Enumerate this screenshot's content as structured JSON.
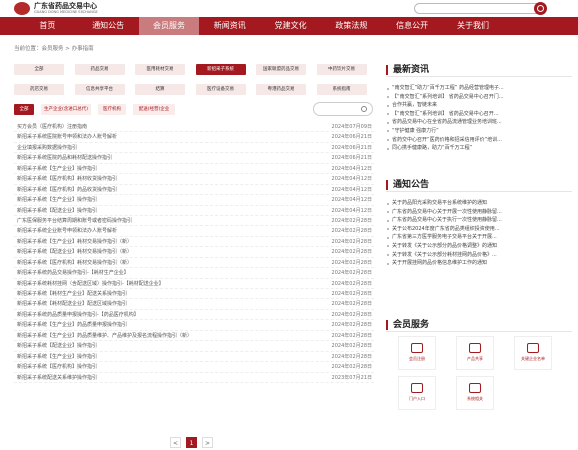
{
  "header": {
    "site_name": "广东省药品交易中心",
    "site_name_en": "GUANG DONG MEDICINE EXCHANGE"
  },
  "nav": {
    "items": [
      "首页",
      "通知公告",
      "会员服务",
      "新闻资讯",
      "党建文化",
      "政策法规",
      "信息公开",
      "关于我们"
    ],
    "active_index": 2
  },
  "breadcrumb": "当前位置：会员服务 > 办事指南",
  "category_tabs": [
    "全部",
    "药品交易",
    "医用耗材交易",
    "新招采子系统",
    "国家联盟药品交易",
    "中药饮片交易",
    "药店交易",
    "信息共享平台",
    "结算",
    "医疗设备交易",
    "粤港药品交易",
    "系统指南"
  ],
  "active_tab": "新招采子系统",
  "filters": [
    "全部",
    "生产企业(含进口总代)",
    "医疗机构",
    "配送(经营)企业"
  ],
  "active_filter": "全部",
  "list": [
    {
      "title": "买方会员（医疗机构）注册指南",
      "date": "2024年07月09日"
    },
    {
      "title": "新招采子系统医院账号申领和法办人账号解析",
      "date": "2024年06月21日"
    },
    {
      "title": "企业填报采购数据操作指引",
      "date": "2024年06月21日"
    },
    {
      "title": "新招采子系统医院药品和耗材配送操作指引",
      "date": "2024年06月21日"
    },
    {
      "title": "新招采子系统【生产企业】操作指引",
      "date": "2024年04月12日"
    },
    {
      "title": "新招采子系统【医疗机构】耗材收货操作指引",
      "date": "2024年04月12日"
    },
    {
      "title": "新招采子系统【医疗机构】药品收货操作指引",
      "date": "2024年04月12日"
    },
    {
      "title": "新招采子系统【生产企业】操作指引",
      "date": "2024年04月12日"
    },
    {
      "title": "新招采子系统【配送企业】操作指引",
      "date": "2024年04月12日"
    },
    {
      "title": "广东医保服务平台结算周期和账号或者密码操作指引",
      "date": "2024年02月28日"
    },
    {
      "title": "新招采子系统企业账号申领和法办人账号解析",
      "date": "2024年02月28日"
    },
    {
      "title": "新招采子系统【生产企业】耗材交易操作指引（新）",
      "date": "2024年02月28日"
    },
    {
      "title": "新招采子系统【配送企业】耗材交易操作指引（新）",
      "date": "2024年02月28日"
    },
    {
      "title": "新招采子系统【医疗机构】耗材交易操作指引（新）",
      "date": "2024年02月28日"
    },
    {
      "title": "新招采子系统药品交易操作指引-【耗材生产企业】",
      "date": "2024年02月28日"
    },
    {
      "title": "新招采子系统耗材挂网（含配送区域）操作指引-【耗材配送企业】",
      "date": "2024年02月28日"
    },
    {
      "title": "新招采子系统【耗材生产企业】配送关系操作指引",
      "date": "2024年02月28日"
    },
    {
      "title": "新招采子系统【耗材配送企业】配送区域操作指引",
      "date": "2024年02月28日"
    },
    {
      "title": "新招采子系统药品质量申报操作指引-【药品医疗机构】",
      "date": "2024年02月28日"
    },
    {
      "title": "新招采子系统【生产企业】药品质量申报操作指引",
      "date": "2024年02月28日"
    },
    {
      "title": "新招采子系统【生产企业】药品质量维护、产品维护及报名流程操作指引（新）",
      "date": "2024年02月28日"
    },
    {
      "title": "新招采子系统【配送企业】操作指引",
      "date": "2024年02月28日"
    },
    {
      "title": "新招采子系统【生产企业】操作指引",
      "date": "2024年02月28日"
    },
    {
      "title": "新招采子系统【医疗机构】操作指引",
      "date": "2024年02月28日"
    },
    {
      "title": "新招采子系统配送关系维护操作指引",
      "date": "2023年07月21日"
    }
  ],
  "pagination": {
    "prev": "<",
    "current": "1",
    "next": ">"
  },
  "news": {
    "title": "最新资讯",
    "items": [
      "“南交智汇”助力“百千万工程” 药品经营管理电子...",
      "【“南交智汇”系列培训】 省药品交易中心召开门...",
      "合作共赢，智链未来",
      "【“南交智汇”系列培训】 省药品交易中心召开...",
      "省药品交易中心在全省药品流通管理业务培训班...",
      "“守护健康 强康力行”",
      "省药交中心召开“医药价格和招采信用评价”培训...",
      "同心携手健康路，助力“百千万工程”"
    ]
  },
  "notices": {
    "title": "通知公告",
    "items": [
      "关于药品阳光采购交易平台系统维护的通知",
      "广东省药品交易中心关于开展一次性使用静脉留...",
      "广东省药品交易中心关于执行一次性使用静脉留...",
      "关于公布2024年度广东省药品类组织投资使用...",
      "广东省第三方医学服务电子交易平台关于开展...",
      "关于转发《关于公示部分药品价格调整》的通知",
      "关于转发《关于公示部分耗材挂网药品价格》...",
      "关于开展挂网药品价格信息维护工作的通知"
    ]
  },
  "services": {
    "title": "会员服务",
    "items": [
      {
        "label": "会员注册",
        "icon": "register-icon"
      },
      {
        "label": "产品共享",
        "icon": "product-icon"
      },
      {
        "label": "关键企业名单",
        "icon": "enterprise-icon"
      },
      {
        "label": "门户入口",
        "icon": "portal-icon"
      },
      {
        "label": "系统相关",
        "icon": "system-icon"
      }
    ]
  },
  "colors": {
    "brand": "#a3191f",
    "nav_active": "#c97b7d"
  }
}
